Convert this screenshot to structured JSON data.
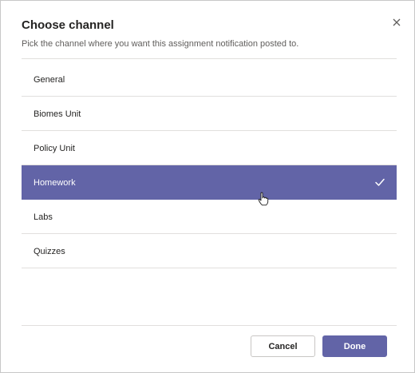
{
  "dialog": {
    "title": "Choose channel",
    "subtitle": "Pick the channel where you want this assignment notification posted to.",
    "close_icon": "close-icon"
  },
  "channels": [
    {
      "label": "General",
      "selected": false
    },
    {
      "label": "Biomes Unit",
      "selected": false
    },
    {
      "label": "Policy Unit",
      "selected": false
    },
    {
      "label": "Homework",
      "selected": true
    },
    {
      "label": "Labs",
      "selected": false
    },
    {
      "label": "Quizzes",
      "selected": false
    }
  ],
  "selected_icon": "checkmark-icon",
  "pointer_icon": "hand-pointer-icon",
  "footer": {
    "cancel_label": "Cancel",
    "done_label": "Done"
  },
  "colors": {
    "accent": "#6264a7",
    "divider": "#e1dfdd",
    "text": "#252423"
  }
}
